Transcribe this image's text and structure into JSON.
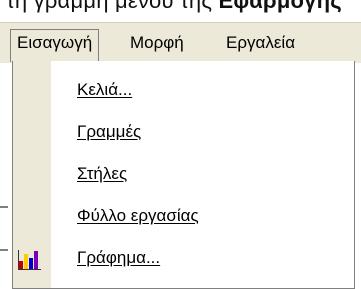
{
  "top_strip": {
    "text_before": "τη γραμμή μενού της ",
    "text_bold": "Εφαρμογής"
  },
  "menubar": {
    "insert": "Εισαγωγή",
    "format": "Μορφή",
    "tools": "Εργαλεία"
  },
  "dropdown": {
    "items": [
      {
        "label": "Κελιά..."
      },
      {
        "label": "Γραμμές"
      },
      {
        "label": "Στήλες"
      },
      {
        "label": "Φύλλο εργασίας"
      },
      {
        "label": "Γράφημα..."
      }
    ]
  },
  "icons": {
    "chart": "chart-icon"
  }
}
